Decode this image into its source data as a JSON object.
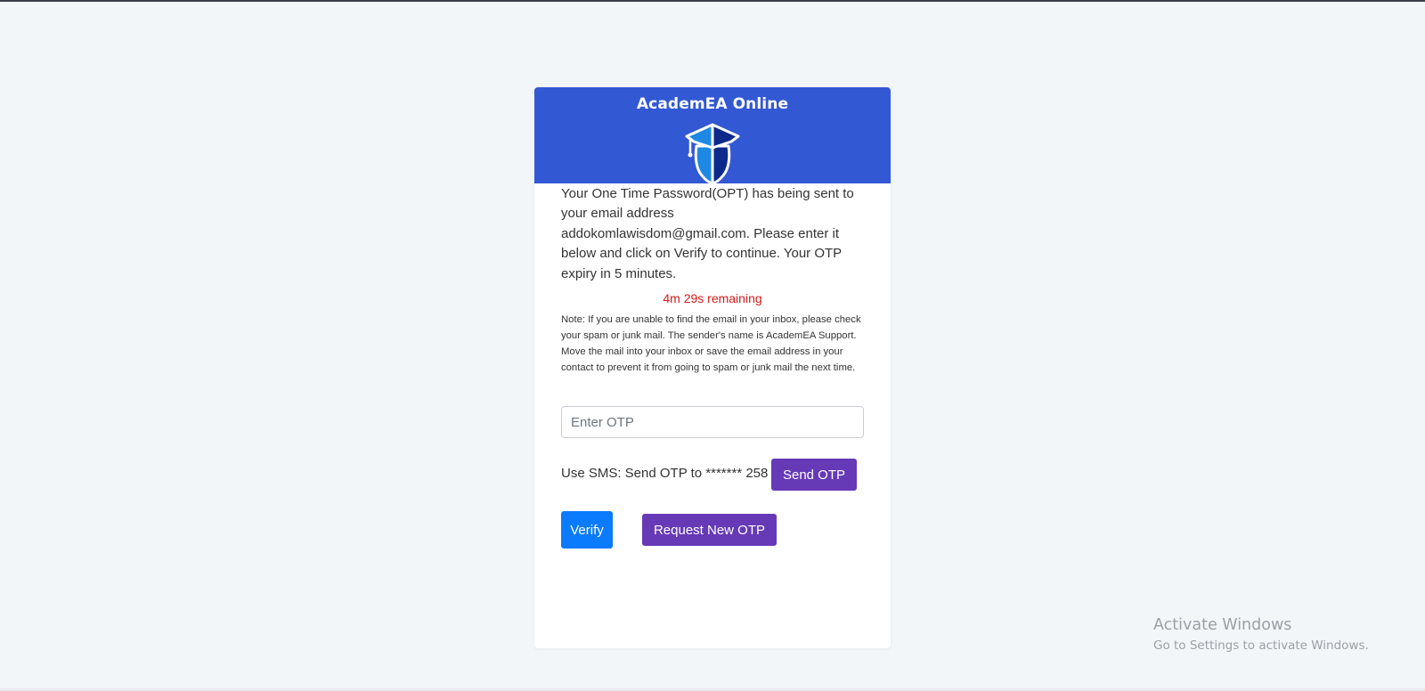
{
  "app": {
    "title": "AcademEA Online",
    "logo_icon": "graduation-cap-head-icon"
  },
  "otp": {
    "message": "Your One Time Password(OPT) has being sent to your email address addokomlawisdom@gmail.com. Please enter it below and click on Verify to continue. Your OTP expiry in 5 minutes.",
    "countdown": "4m 29s remaining",
    "note": "Note: If you are unable to find the email in your inbox, please check your spam or junk mail. The sender's name is AcademEA Support. Move the mail into your inbox or save the email address in your contact to prevent it from going to spam or junk mail the next time.",
    "input_placeholder": "Enter OTP",
    "input_value": ""
  },
  "sms": {
    "label": "Use SMS: Send OTP to ******* 258",
    "send_button": "Send OTP"
  },
  "actions": {
    "verify_button": "Verify",
    "request_new_button": "Request New OTP"
  },
  "watermark": {
    "title": "Activate Windows",
    "subtitle": "Go to Settings to activate Windows."
  },
  "colors": {
    "header": "#3358d4",
    "primary_button": "#0b7bfd",
    "secondary_button": "#6639b7",
    "countdown": "#d11a1a",
    "page_background": "#f3f6f9"
  }
}
